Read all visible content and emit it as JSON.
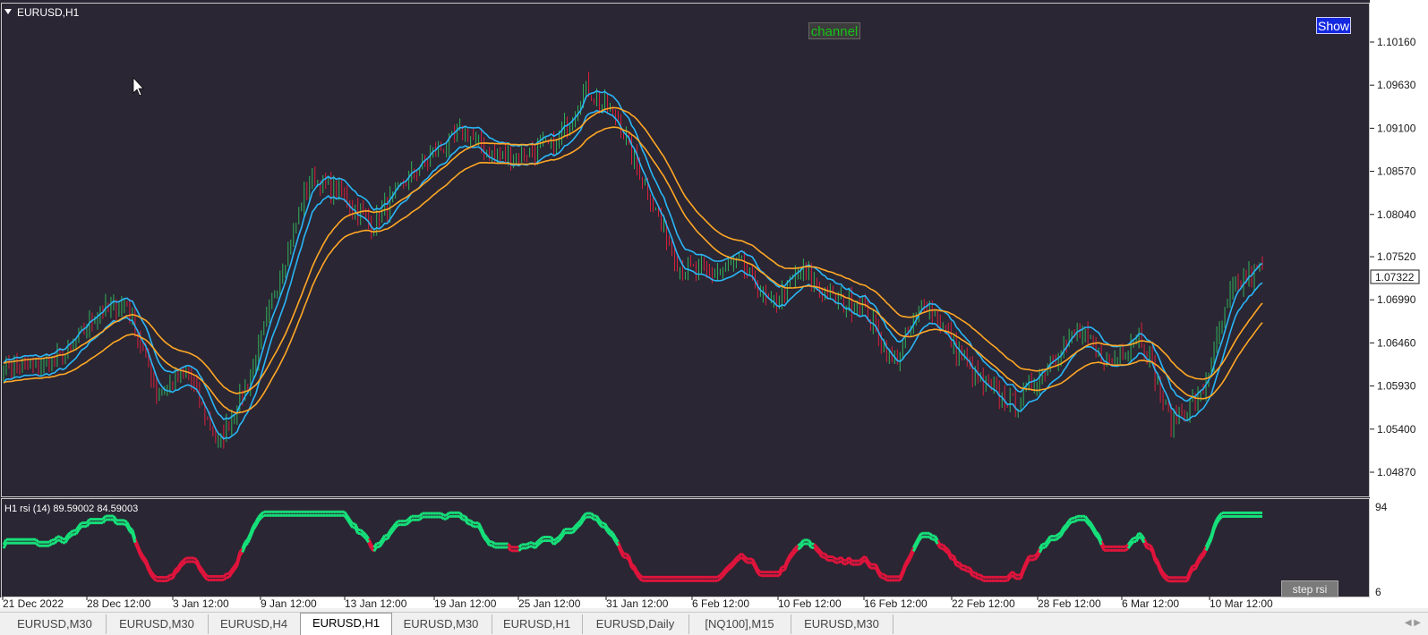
{
  "window": {
    "symbol_title": "EURUSD,H1"
  },
  "buttons": {
    "show": "Show",
    "channel": "channel",
    "step_rsi": "step rsi"
  },
  "price_axis": {
    "ticks": [
      "1.10160",
      "1.09630",
      "1.09100",
      "1.08570",
      "1.08040",
      "1.07520",
      "1.06990",
      "1.06460",
      "1.05930",
      "1.05400",
      "1.04870"
    ],
    "current_price": "1.07322"
  },
  "indicator": {
    "label": "H1 rsi (14) 89.59002 84.59003",
    "scale_top": "94",
    "scale_bottom": "6"
  },
  "time_axis": [
    "21 Dec 2022",
    "28 Dec 12:00",
    "3 Jan 12:00",
    "9 Jan 12:00",
    "13 Jan 12:00",
    "19 Jan 12:00",
    "25 Jan 12:00",
    "31 Jan 12:00",
    "6 Feb 12:00",
    "10 Feb 12:00",
    "16 Feb 12:00",
    "22 Feb 12:00",
    "28 Feb 12:00",
    "6 Mar 12:00",
    "10 Mar 12:00"
  ],
  "tabs": [
    {
      "label": "EURUSD,M30",
      "active": false
    },
    {
      "label": "EURUSD,M30",
      "active": false
    },
    {
      "label": "EURUSD,H4",
      "active": false
    },
    {
      "label": "EURUSD,H1",
      "active": true
    },
    {
      "label": "EURUSD,M30",
      "active": false
    },
    {
      "label": "EURUSD,H1",
      "active": false
    },
    {
      "label": "EURUSD,Daily",
      "active": false
    },
    {
      "label": "[NQ100],M15",
      "active": false
    },
    {
      "label": "EURUSD,M30",
      "active": false
    }
  ],
  "colors": {
    "background": "#2a2633",
    "bull_candle": "#2fb35a",
    "bear_candle": "#d8203c",
    "fast_band": "#29b6f6",
    "slow_band": "#ffa726",
    "rsi_up": "#16e07a",
    "rsi_down": "#e0143c"
  },
  "chart_data": {
    "type": "line",
    "title": "EURUSD,H1",
    "ylim": [
      1.0455,
      1.1045
    ],
    "x_labels": [
      "21 Dec 2022",
      "28 Dec 12:00",
      "3 Jan 12:00",
      "9 Jan 12:00",
      "13 Jan 12:00",
      "19 Jan 12:00",
      "25 Jan 12:00",
      "31 Jan 12:00",
      "6 Feb 12:00",
      "10 Feb 12:00",
      "16 Feb 12:00",
      "22 Feb 12:00",
      "28 Feb 12:00",
      "6 Mar 12:00",
      "10 Mar 12:00"
    ],
    "close_anchors": [
      1.062,
      1.0615,
      1.063,
      1.068,
      1.0695,
      1.0585,
      1.061,
      1.052,
      1.06,
      1.073,
      1.085,
      1.083,
      1.079,
      1.084,
      1.088,
      1.0905,
      1.0875,
      1.088,
      1.089,
      1.096,
      1.092,
      1.083,
      1.074,
      1.073,
      1.0745,
      1.069,
      1.0735,
      1.07,
      1.069,
      1.062,
      1.07,
      1.064,
      1.059,
      1.057,
      1.062,
      1.066,
      1.062,
      1.066,
      1.055,
      1.058,
      1.071,
      1.074
    ]
  }
}
